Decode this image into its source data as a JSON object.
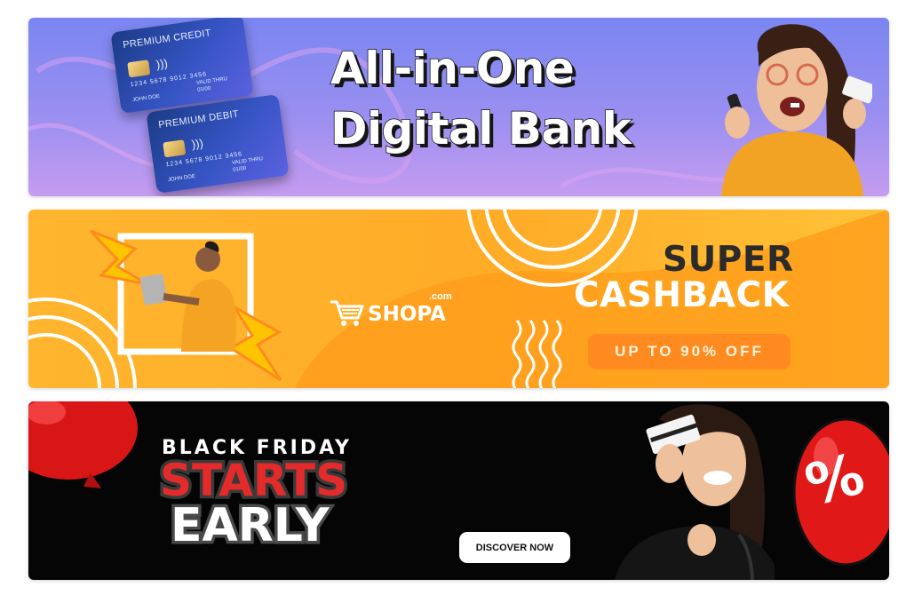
{
  "banners": [
    {
      "id": "digital-bank",
      "cards": [
        {
          "title": "PREMIUM CREDIT",
          "number": "1234  5678  9012  3456",
          "holder": "JOHN DOE",
          "expiry_label": "VALID THRU",
          "expiry": "01/00"
        },
        {
          "title": "PREMIUM DEBIT",
          "number": "1234  5678  9012  3456",
          "holder": "JOHN DOE",
          "expiry_label": "VALID THRU",
          "expiry": "01/00"
        }
      ],
      "headline_line1": "All-in-One",
      "headline_line2": "Digital Bank"
    },
    {
      "id": "super-cashback",
      "brand_name": "SHOPA",
      "brand_suffix": ".com",
      "headline_line1": "SUPER",
      "headline_line2": "CASHBACK",
      "offer": "UP TO 90% OFF"
    },
    {
      "id": "black-friday",
      "line1": "BLACK FRIDAY",
      "line2": "STARTS",
      "line3": "EARLY",
      "cta_label": "DISCOVER NOW",
      "balloon_symbol": "%"
    }
  ],
  "colors": {
    "bank_bg": "#8f8cf0",
    "cashback_bg": "#ffb22c",
    "offer_pill": "#ff8a1f",
    "black_friday_bg": "#050505",
    "starts_red": "#e42b2b",
    "balloon_red": "#e01818"
  }
}
